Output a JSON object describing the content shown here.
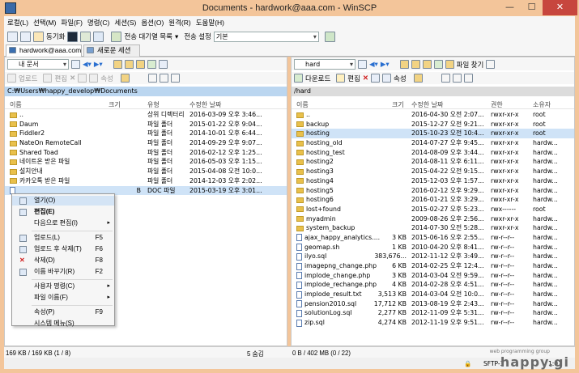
{
  "window": {
    "title": "Documents - hardwork@aaa.com - WinSCP",
    "min": "—",
    "max": "☐",
    "close": "✕"
  },
  "menu": [
    "로컬(L)",
    "선택(M)",
    "파일(F)",
    "명령(C)",
    "세션(S)",
    "옵션(O)",
    "원격(R)",
    "도움말(H)"
  ],
  "toolbar": {
    "sync": "동기화",
    "queue": "전송 대기열 목록",
    "transfer_label": "전송 설정",
    "transfer_value": "기본"
  },
  "tabs": {
    "session": "hardwork@aaa.com",
    "new": "새로운 세션"
  },
  "left": {
    "location": "내 문서",
    "upload": "업로드",
    "edit": "편집",
    "props": "속성",
    "path": "C:₩Users₩happy_develop₩Documents",
    "columns": {
      "name": "이름",
      "size": "크기",
      "type": "유형",
      "date": "수정한 날짜"
    },
    "rows": [
      {
        "name": "..",
        "size": "",
        "type": "상위 디렉터리",
        "date": "2016-03-09  오후 3:46..."
      },
      {
        "name": "Daum",
        "size": "",
        "type": "파일 폴더",
        "date": "2015-01-22  오후 9:04..."
      },
      {
        "name": "Fiddler2",
        "size": "",
        "type": "파일 폴더",
        "date": "2014-10-01  오후 6:44..."
      },
      {
        "name": "NateOn RemoteCall",
        "size": "",
        "type": "파일 폴더",
        "date": "2014-09-29  오후 9:07..."
      },
      {
        "name": "Shared Toad",
        "size": "",
        "type": "파일 폴더",
        "date": "2016-02-12  오후 1:25..."
      },
      {
        "name": "네이트온 받은 파일",
        "size": "",
        "type": "파일 폴더",
        "date": "2016-05-03  오후 1:15..."
      },
      {
        "name": "설치안내",
        "size": "",
        "type": "파일 폴더",
        "date": "2015-04-08  오전 10:0..."
      },
      {
        "name": "카카오톡 받은 파일",
        "size": "",
        "type": "파일 폴더",
        "date": "2014-12-03  오후 2:02..."
      },
      {
        "name": "",
        "size": "B",
        "type": "DOC 파일",
        "date": "2015-03-19  오후 3:01..."
      }
    ],
    "status": "169 KB / 169 KB (1 / 8)",
    "hidden": "5 숨김"
  },
  "right": {
    "location": "hard",
    "download": "다운로드",
    "edit": "편집",
    "props": "속성",
    "find": "파일 찾기",
    "path": "/hard",
    "columns": {
      "name": "이름",
      "size": "크기",
      "date": "수정한 날짜",
      "perm": "권한",
      "owner": "소유자"
    },
    "rows": [
      {
        "name": "..",
        "size": "",
        "date": "2016-04-30  오전 2:07...",
        "perm": "rwxr-xr-x",
        "owner": "root",
        "kind": "up"
      },
      {
        "name": "backup",
        "size": "",
        "date": "2015-12-27  오전 9:21...",
        "perm": "rwxr-xr-x",
        "owner": "root",
        "kind": "dir"
      },
      {
        "name": "hosting",
        "size": "",
        "date": "2015-10-23  오전 10:4...",
        "perm": "rwxr-xr-x",
        "owner": "root",
        "kind": "dir"
      },
      {
        "name": "hosting_old",
        "size": "",
        "date": "2014-07-27  오후 9:45...",
        "perm": "rwxr-xr-x",
        "owner": "hardw...",
        "kind": "dir"
      },
      {
        "name": "hosting_test",
        "size": "",
        "date": "2014-08-09  오후 3:44...",
        "perm": "rwxr-xr-x",
        "owner": "hardw...",
        "kind": "dir"
      },
      {
        "name": "hosting2",
        "size": "",
        "date": "2014-08-11  오후 6:11...",
        "perm": "rwxr-xr-x",
        "owner": "hardw...",
        "kind": "dir"
      },
      {
        "name": "hosting3",
        "size": "",
        "date": "2015-04-22  오전 9:15...",
        "perm": "rwxr-xr-x",
        "owner": "hardw...",
        "kind": "dir"
      },
      {
        "name": "hosting4",
        "size": "",
        "date": "2015-12-03  오후 1:57...",
        "perm": "rwxr-xr-x",
        "owner": "hardw...",
        "kind": "dir"
      },
      {
        "name": "hosting5",
        "size": "",
        "date": "2016-02-12  오후 9:29...",
        "perm": "rwxr-xr-x",
        "owner": "hardw...",
        "kind": "dir"
      },
      {
        "name": "hosting6",
        "size": "",
        "date": "2016-01-21  오후 3:29...",
        "perm": "rwxr-xr-x",
        "owner": "hardw...",
        "kind": "dir"
      },
      {
        "name": "lost+found",
        "size": "",
        "date": "2015-02-27  오후 5:23...",
        "perm": "rwx------",
        "owner": "root",
        "kind": "dir"
      },
      {
        "name": "myadmin",
        "size": "",
        "date": "2009-08-26  오후 2:56...",
        "perm": "rwxr-xr-x",
        "owner": "hardw...",
        "kind": "dir"
      },
      {
        "name": "system_backup",
        "size": "",
        "date": "2014-07-30  오전 5:28...",
        "perm": "rwxr-xr-x",
        "owner": "hardw...",
        "kind": "dir"
      },
      {
        "name": "ajax_happy_analytics....",
        "size": "3 KB",
        "date": "2015-06-16  오후 2:55...",
        "perm": "rw-r--r--",
        "owner": "hardw...",
        "kind": "file"
      },
      {
        "name": "geomap.sh",
        "size": "1 KB",
        "date": "2010-04-20  오후 8:41...",
        "perm": "rw-r--r--",
        "owner": "hardw...",
        "kind": "file"
      },
      {
        "name": "ilyo.sql",
        "size": "383,676...",
        "date": "2012-11-12  오후 3:49...",
        "perm": "rw-r--r--",
        "owner": "hardw...",
        "kind": "file"
      },
      {
        "name": "imagepng_change.php",
        "size": "6 KB",
        "date": "2014-02-25  오후 12:4...",
        "perm": "rw-r--r--",
        "owner": "hardw...",
        "kind": "file"
      },
      {
        "name": "implode_change.php",
        "size": "3 KB",
        "date": "2014-03-04  오전 9:59...",
        "perm": "rw-r--r--",
        "owner": "hardw...",
        "kind": "file"
      },
      {
        "name": "implode_rechange.php",
        "size": "4 KB",
        "date": "2014-02-28  오후 4:51...",
        "perm": "rw-r--r--",
        "owner": "hardw...",
        "kind": "file"
      },
      {
        "name": "implode_result.txt",
        "size": "3,513 KB",
        "date": "2014-03-04  오전 10:0...",
        "perm": "rw-r--r--",
        "owner": "hardw...",
        "kind": "file"
      },
      {
        "name": "pension2010.sql",
        "size": "17,712 KB",
        "date": "2013-08-19  오후 2:43...",
        "perm": "rw-r--r--",
        "owner": "hardw...",
        "kind": "file"
      },
      {
        "name": "solutionLog.sql",
        "size": "2,277 KB",
        "date": "2012-11-09  오후 5:31...",
        "perm": "rw-r--r--",
        "owner": "hardw...",
        "kind": "file"
      },
      {
        "name": "zip.sql",
        "size": "4,274 KB",
        "date": "2012-11-19  오후 9:51...",
        "perm": "rw-r--r--",
        "owner": "hardw...",
        "kind": "file"
      }
    ],
    "status": "0 B / 402 MB (0 / 22)"
  },
  "context_menu": [
    {
      "label": "열기(O)",
      "shortcut": "",
      "arrow": ""
    },
    {
      "label": "편집(E)",
      "shortcut": "",
      "arrow": ""
    },
    {
      "label": "다음으로 편집(I)",
      "shortcut": "",
      "arrow": "▸"
    },
    {
      "label": "업로드(L)",
      "shortcut": "F5",
      "arrow": ""
    },
    {
      "label": "업로드 후 삭제(T)",
      "shortcut": "F6",
      "arrow": ""
    },
    {
      "label": "삭제(D)",
      "shortcut": "F8",
      "arrow": ""
    },
    {
      "label": "이름 바꾸기(R)",
      "shortcut": "F2",
      "arrow": ""
    },
    {
      "label": "사용자 명령(C)",
      "shortcut": "",
      "arrow": "▸"
    },
    {
      "label": "파일 이름(F)",
      "shortcut": "",
      "arrow": "▸"
    },
    {
      "label": "속성(P)",
      "shortcut": "F9",
      "arrow": ""
    },
    {
      "label": "시스템 메뉴(S)",
      "shortcut": "",
      "arrow": ""
    }
  ],
  "bottom": {
    "protocol": "SFTP-3",
    "time": "1:01"
  },
  "watermark": {
    "big": "happy.gi",
    "small": "web programming group"
  },
  "colors": {
    "titlebar": "#f3c59a",
    "close": "#c7463e",
    "selection": "#cfe3f7",
    "folder": "#e9c04b"
  }
}
